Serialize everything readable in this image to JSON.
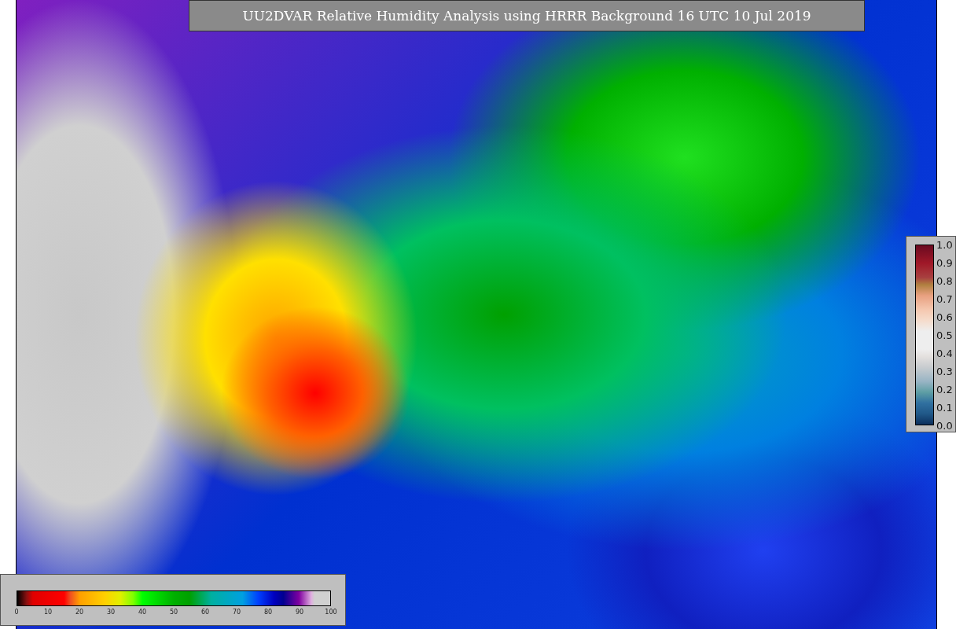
{
  "title": "UU2DVAR Relative Humidity Analysis using HRRR Background 16 UTC 10 Jul 2019",
  "humidity_colorbar": {
    "ticks": [
      "0",
      "10",
      "20",
      "30",
      "40",
      "50",
      "60",
      "70",
      "80",
      "90",
      "100"
    ]
  },
  "ratio_colorbar": {
    "ticks": [
      "1.0",
      "0.9",
      "0.8",
      "0.7",
      "0.6",
      "0.5",
      "0.4",
      "0.3",
      "0.2",
      "0.1",
      "0.0"
    ]
  }
}
